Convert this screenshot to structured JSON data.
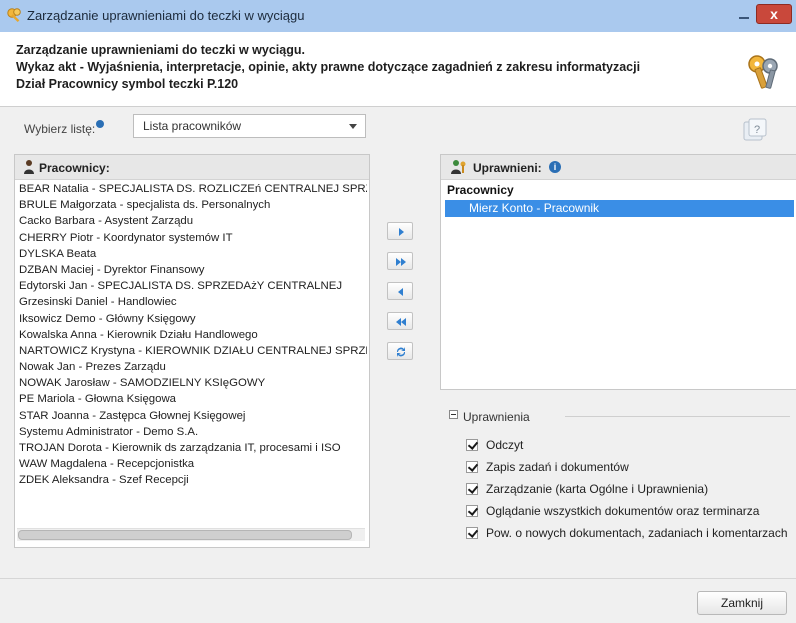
{
  "window": {
    "title": "Zarządzanie uprawnieniami do teczki w wyciągu",
    "close_label": "x"
  },
  "header": {
    "line1": "Zarządzanie uprawnieniami do teczki w wyciągu.",
    "line2": "Wykaz akt - Wyjaśnienia, interpretacje, opinie, akty prawne dotyczące zagadnień z zakresu informatyzacji",
    "line3": "Dział Pracownicy symbol teczki P.120"
  },
  "selector": {
    "label": "Wybierz listę:",
    "value": "Lista pracowników"
  },
  "left_panel": {
    "title": "Pracownicy:",
    "items": [
      "BEAR Natalia - SPECJALISTA DS. ROZLICZEń CENTRALNEJ SPRZEDA",
      "BRULE Małgorzata - specjalista ds. Personalnych",
      "Cacko Barbara - Asystent Zarządu",
      "CHERRY Piotr - Koordynator systemów IT",
      "DYLSKA Beata",
      "DZBAN Maciej - Dyrektor Finansowy",
      "Edytorski Jan - SPECJALISTA DS. SPRZEDAżY CENTRALNEJ",
      "Grzesinski Daniel - Handlowiec",
      "Iksowicz Demo - Główny Księgowy",
      "Kowalska Anna - Kierownik Działu Handlowego",
      "NARTOWICZ Krystyna - KIEROWNIK DZIAŁU CENTRALNEJ SPRZED/",
      "Nowak Jan - Prezes Zarządu",
      "NOWAK Jarosław - SAMODZIELNY KSIęGOWY",
      "PE Mariola - Głowna Księgowa",
      "STAR Joanna - Zastępca Głownej Księgowej",
      "Systemu Administrator - Demo S.A.",
      "TROJAN Dorota - Kierownik ds zarządzania IT, procesami i ISO",
      "WAW Magdalena - Recepcjonistka",
      "ZDEK Aleksandra - Szef Recepcji"
    ]
  },
  "right_panel": {
    "title": "Uprawnieni:",
    "group": "Pracownicy",
    "selected_item": "Mierz Konto - Pracownik"
  },
  "permissions": {
    "title": "Uprawnienia",
    "items": [
      {
        "label": "Odczyt",
        "checked": true
      },
      {
        "label": "Zapis zadań i dokumentów",
        "checked": true
      },
      {
        "label": "Zarządzanie (karta Ogólne i Uprawnienia)",
        "checked": true
      },
      {
        "label": "Oglądanie wszystkich dokumentów oraz terminarza",
        "checked": true
      },
      {
        "label": "Pow. o nowych dokumentach, zadaniach i komentarzach",
        "checked": true
      }
    ]
  },
  "footer": {
    "close_label": "Zamknij"
  },
  "colors": {
    "titlebar": "#aac9ee",
    "selection": "#3a8ee6",
    "close_button": "#c9483b"
  },
  "icons": [
    "keys-icon",
    "user-icon",
    "users-permission-icon",
    "info-icon",
    "help-icon",
    "arrow-right-icon",
    "double-arrow-right-icon",
    "arrow-left-icon",
    "double-arrow-left-icon",
    "refresh-icon"
  ]
}
